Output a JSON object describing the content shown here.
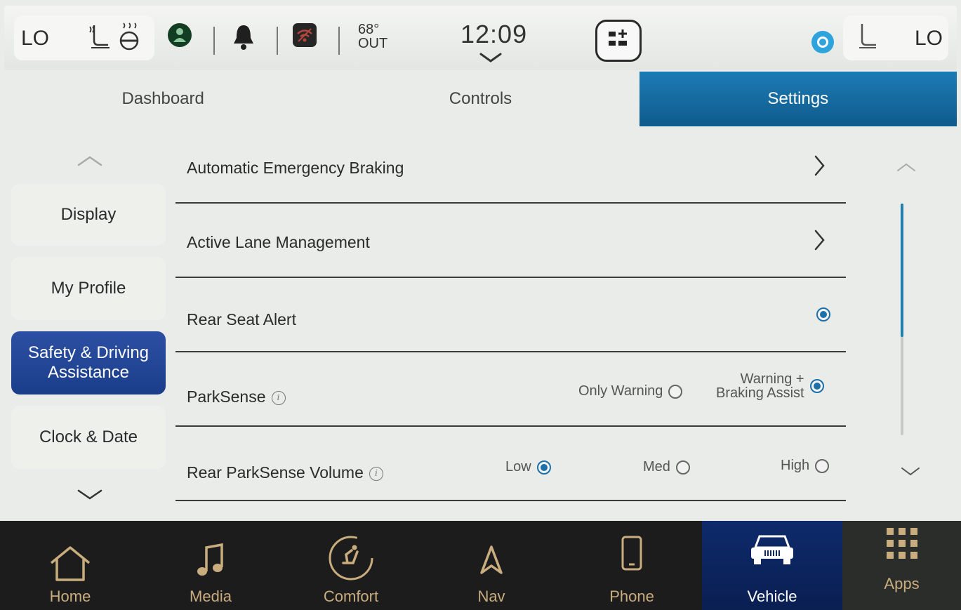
{
  "status_bar": {
    "left_temp": "LO",
    "right_temp": "LO",
    "outside_temp": "68°",
    "outside_label": "OUT",
    "time": "12:09"
  },
  "tabs": [
    {
      "label": "Dashboard",
      "active": false
    },
    {
      "label": "Controls",
      "active": false
    },
    {
      "label": "Settings",
      "active": true
    }
  ],
  "sidebar": {
    "items": [
      {
        "label": "Display",
        "active": false
      },
      {
        "label": "My Profile",
        "active": false
      },
      {
        "label": "Safety & Driving\nAssistance",
        "active": true
      },
      {
        "label": "Clock & Date",
        "active": false
      }
    ]
  },
  "settings": {
    "rows": [
      {
        "label": "Automatic Emergency Braking",
        "type": "submenu"
      },
      {
        "label": "Active Lane Management",
        "type": "submenu"
      },
      {
        "label": "Rear Seat Alert",
        "type": "toggle",
        "checked": true
      },
      {
        "label": "ParkSense",
        "type": "options",
        "info": true,
        "options": [
          {
            "label": "Only Warning",
            "selected": false
          },
          {
            "label_line1": "Warning +",
            "label_line2": "Braking Assist",
            "selected": true
          }
        ]
      },
      {
        "label": "Rear ParkSense Volume",
        "type": "options",
        "info": true,
        "options": [
          {
            "label": "Low",
            "selected": true
          },
          {
            "label": "Med",
            "selected": false
          },
          {
            "label": "High",
            "selected": false
          }
        ]
      }
    ]
  },
  "bottom_nav": {
    "items": [
      {
        "label": "Home",
        "active": false
      },
      {
        "label": "Media",
        "active": false
      },
      {
        "label": "Comfort",
        "active": false
      },
      {
        "label": "Nav",
        "active": false
      },
      {
        "label": "Phone",
        "active": false
      },
      {
        "label": "Vehicle",
        "active": true
      },
      {
        "label": "Apps",
        "active": false
      }
    ]
  },
  "colors": {
    "accent_blue": "#1c7bb4",
    "sidebar_active": "#2d4fa3",
    "nav_text": "#c9ad7f",
    "nav_active_bg": "#0e2a6b"
  }
}
